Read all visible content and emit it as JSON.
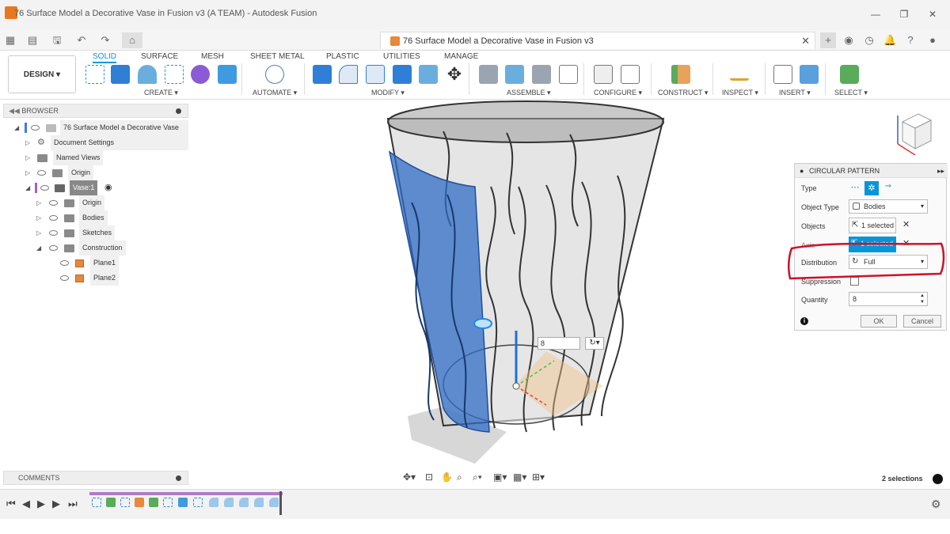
{
  "window": {
    "title": "76 Surface Model a Decorative Vase in Fusion v3 (A TEAM) - Autodesk Fusion"
  },
  "document_tab": {
    "title": "76 Surface Model a Decorative Vase in Fusion v3"
  },
  "ribbon": {
    "workspace": "DESIGN",
    "tabs": [
      "SOLID",
      "SURFACE",
      "MESH",
      "SHEET METAL",
      "PLASTIC",
      "UTILITIES",
      "MANAGE"
    ],
    "active_tab": "SOLID",
    "groups": {
      "create": "CREATE",
      "automate": "AUTOMATE",
      "modify": "MODIFY",
      "assemble": "ASSEMBLE",
      "configure": "CONFIGURE",
      "construct": "CONSTRUCT",
      "inspect": "INSPECT",
      "insert": "INSERT",
      "select": "SELECT"
    }
  },
  "browser": {
    "header": "BROWSER",
    "root": "76 Surface Model a Decorative Vase ...",
    "items": [
      {
        "label": "Document Settings"
      },
      {
        "label": "Named Views"
      },
      {
        "label": "Origin"
      },
      {
        "label": "Vase:1"
      },
      {
        "label": "Origin"
      },
      {
        "label": "Bodies"
      },
      {
        "label": "Sketches"
      },
      {
        "label": "Construction"
      },
      {
        "label": "Plane1"
      },
      {
        "label": "Plane2"
      }
    ]
  },
  "comments": {
    "header": "COMMENTS"
  },
  "circular_pattern": {
    "title": "CIRCULAR PATTERN",
    "labels": {
      "type": "Type",
      "object_type": "Object Type",
      "objects": "Objects",
      "axis": "Axis",
      "distribution": "Distribution",
      "suppression": "Suppression",
      "quantity": "Quantity"
    },
    "object_type_value": "Bodies",
    "objects_value": "1 selected",
    "axis_value": "1 selected",
    "distribution_value": "Full",
    "quantity_value": "8",
    "ok_label": "OK",
    "cancel_label": "Cancel"
  },
  "viewport": {
    "quantity_input": "8"
  },
  "status": {
    "selections": "2 selections"
  },
  "colors": {
    "accent": "#0696d7",
    "highlight_red": "#d0102a",
    "selection_blue": "#2f6cc4"
  }
}
